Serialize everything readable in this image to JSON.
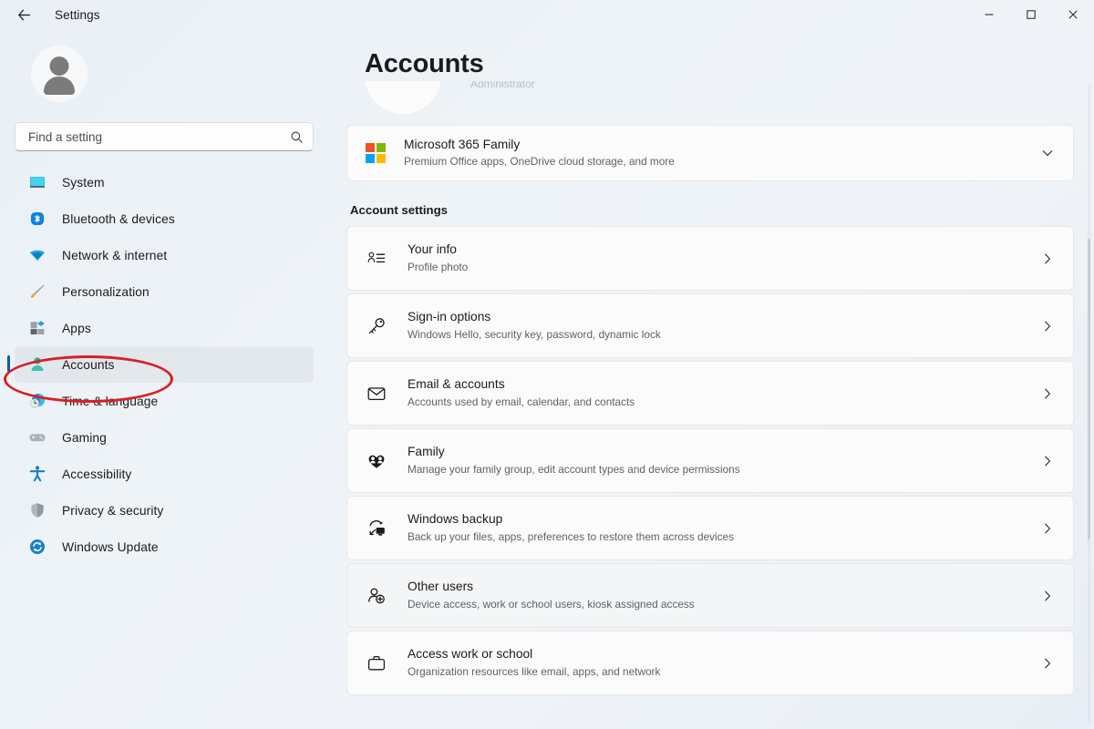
{
  "window": {
    "title": "Settings",
    "back_icon": "back-arrow-icon",
    "minimize_label": "Minimize",
    "maximize_label": "Maximize",
    "close_label": "Close"
  },
  "search": {
    "placeholder": "Find a setting",
    "value": "",
    "icon": "search-icon"
  },
  "sidebar": {
    "avatar_icon": "user-avatar-icon",
    "items": [
      {
        "label": "System",
        "icon": "monitor-icon",
        "selected": false
      },
      {
        "label": "Bluetooth & devices",
        "icon": "bluetooth-icon",
        "selected": false
      },
      {
        "label": "Network & internet",
        "icon": "wifi-icon",
        "selected": false
      },
      {
        "label": "Personalization",
        "icon": "paintbrush-icon",
        "selected": false
      },
      {
        "label": "Apps",
        "icon": "apps-icon",
        "selected": false
      },
      {
        "label": "Accounts",
        "icon": "accounts-icon",
        "selected": true
      },
      {
        "label": "Time & language",
        "icon": "clock-globe-icon",
        "selected": false
      },
      {
        "label": "Gaming",
        "icon": "gamepad-icon",
        "selected": false
      },
      {
        "label": "Accessibility",
        "icon": "accessibility-icon",
        "selected": false
      },
      {
        "label": "Privacy & security",
        "icon": "shield-icon",
        "selected": false
      },
      {
        "label": "Windows Update",
        "icon": "update-icon",
        "selected": false
      }
    ]
  },
  "main": {
    "page_title": "Accounts",
    "profile_fragment": {
      "subtitle": "Administrator"
    },
    "subscription": {
      "title": "Microsoft 365 Family",
      "subtitle": "Premium Office apps, OneDrive cloud storage, and more",
      "logo_icon": "microsoft-logo-icon",
      "expander_icon": "chevron-down-icon",
      "logo_colors": {
        "top_left": "#f25022",
        "top_right": "#7fba00",
        "bottom_left": "#00a4ef",
        "bottom_right": "#ffb900"
      }
    },
    "section_title": "Account settings",
    "settings": [
      {
        "title": "Your info",
        "subtitle": "Profile photo",
        "icon": "contact-card-icon",
        "chevron": "chevron-right-icon",
        "hovered": false
      },
      {
        "title": "Sign-in options",
        "subtitle": "Windows Hello, security key, password, dynamic lock",
        "icon": "key-icon",
        "chevron": "chevron-right-icon",
        "hovered": false
      },
      {
        "title": "Email & accounts",
        "subtitle": "Accounts used by email, calendar, and contacts",
        "icon": "envelope-icon",
        "chevron": "chevron-right-icon",
        "hovered": false
      },
      {
        "title": "Family",
        "subtitle": "Manage your family group, edit account types and device permissions",
        "icon": "family-heart-icon",
        "chevron": "chevron-right-icon",
        "hovered": false
      },
      {
        "title": "Windows backup",
        "subtitle": "Back up your files, apps, preferences to restore them across devices",
        "icon": "backup-icon",
        "chevron": "chevron-right-icon",
        "hovered": false
      },
      {
        "title": "Other users",
        "subtitle": "Device access, work or school users, kiosk assigned access",
        "icon": "add-user-icon",
        "chevron": "chevron-right-icon",
        "hovered": true
      },
      {
        "title": "Access work or school",
        "subtitle": "Organization resources like email, apps, and network",
        "icon": "briefcase-icon",
        "chevron": "chevron-right-icon",
        "hovered": false
      }
    ]
  },
  "annotation": {
    "shape": "ellipse",
    "color": "#d81f26",
    "targets": "Accounts"
  },
  "colors": {
    "accent": "#005fb8",
    "background": "#eef3f7",
    "card": "#fbfbfb",
    "annotation_red": "#d81f26"
  }
}
